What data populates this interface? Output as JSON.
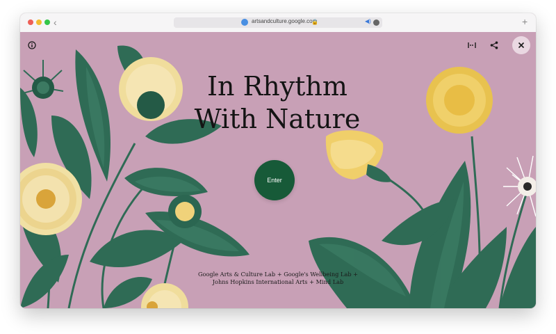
{
  "browser": {
    "url": "artsandculture.google.com"
  },
  "experience": {
    "title_line1": "In Rhythm",
    "title_line2": "With Nature",
    "enter_label": "Enter",
    "credits_line1": "Google Arts & Culture Lab + Google's Wellbeing Lab +",
    "credits_line2": "Johns Hopkins International Arts + Mind Lab"
  },
  "colors": {
    "background": "#c8a0b6",
    "leaf": "#2f6b55",
    "flower_yellow": "#edd071",
    "flower_cream": "#f1e0a4",
    "enter_button": "#175a38"
  },
  "icons": [
    "info-icon",
    "equalizer-icon",
    "share-icon",
    "close-icon"
  ]
}
